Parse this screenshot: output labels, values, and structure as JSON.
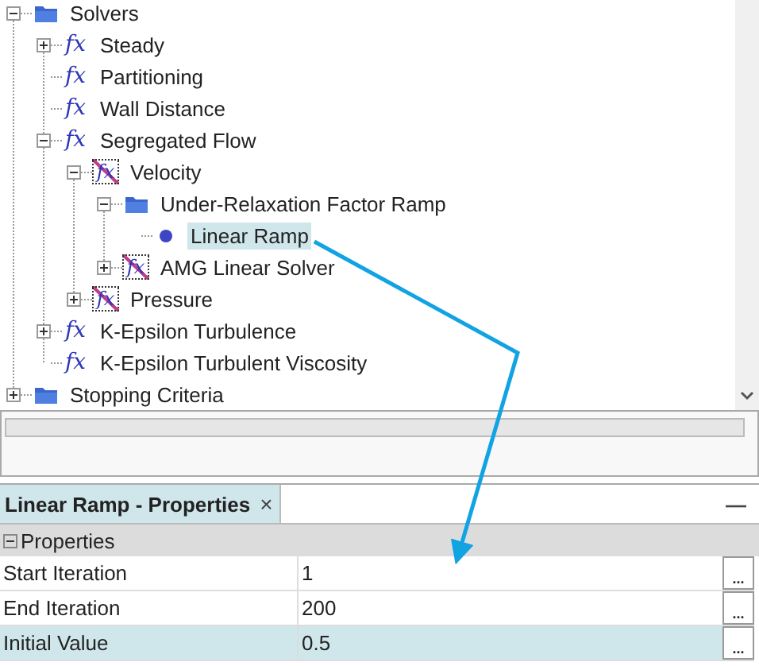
{
  "tree": [
    {
      "label": "Solvers",
      "kind": "folder",
      "expanded": true,
      "selected": false,
      "children": [
        {
          "label": "Steady",
          "kind": "function",
          "symbol": "fx",
          "expanded": false,
          "selected": false
        },
        {
          "label": "Partitioning",
          "kind": "function",
          "symbol": "fx",
          "selected": false
        },
        {
          "label": "Wall Distance",
          "kind": "function",
          "symbol": "fx",
          "selected": false
        },
        {
          "label": "Segregated Flow",
          "kind": "function",
          "symbol": "fx",
          "expanded": true,
          "selected": false,
          "children": [
            {
              "label": "Velocity",
              "kind": "function-off",
              "symbol": "fx",
              "expanded": true,
              "selected": false,
              "children": [
                {
                  "label": "Under-Relaxation Factor Ramp",
                  "kind": "folder",
                  "expanded": true,
                  "selected": false,
                  "children": [
                    {
                      "label": "Linear Ramp",
                      "kind": "value",
                      "selected": true
                    }
                  ]
                },
                {
                  "label": "AMG Linear Solver",
                  "kind": "function-off",
                  "symbol": "fx",
                  "expanded": false,
                  "selected": false
                }
              ]
            },
            {
              "label": "Pressure",
              "kind": "function-off",
              "symbol": "fx",
              "expanded": false,
              "selected": false
            }
          ]
        },
        {
          "label": "K-Epsilon Turbulence",
          "kind": "function",
          "symbol": "fx",
          "expanded": false,
          "selected": false
        },
        {
          "label": "K-Epsilon Turbulent Viscosity",
          "kind": "function",
          "symbol": "fx",
          "selected": false
        }
      ]
    },
    {
      "label": "Stopping Criteria",
      "kind": "folder",
      "expanded": false,
      "selected": false
    }
  ],
  "properties_panel": {
    "tab": {
      "title": "Linear Ramp - Properties",
      "close": "×",
      "selected": true
    },
    "minimize": "—",
    "group": {
      "label": "Properties",
      "expanded": true
    },
    "rows": [
      {
        "name": "Start Iteration",
        "value": "1",
        "edit_button": "...",
        "selected": false
      },
      {
        "name": "End Iteration",
        "value": "200",
        "edit_button": "...",
        "selected": false
      },
      {
        "name": "Initial Value",
        "value": "0.5",
        "edit_button": "...",
        "selected": true
      }
    ]
  }
}
